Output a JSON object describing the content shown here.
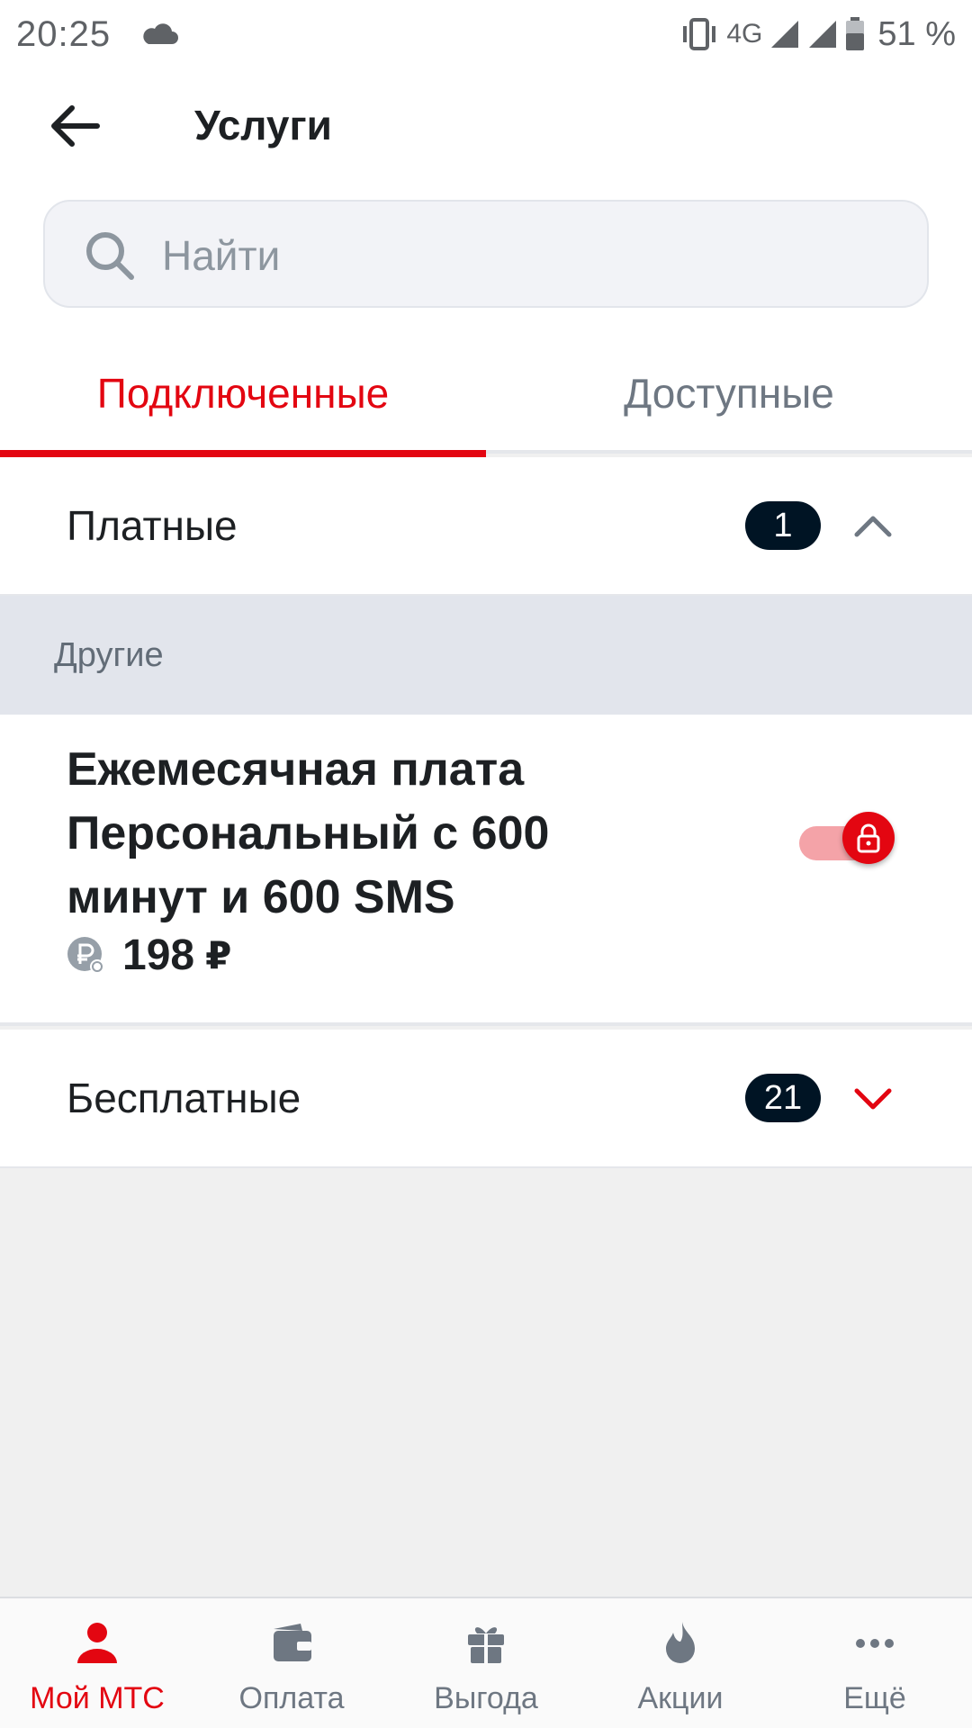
{
  "status_bar": {
    "time": "20:25",
    "network": "4G",
    "battery": "51 %",
    "icons": [
      "cloud-icon",
      "vibrate-icon",
      "signal-icon",
      "battery-icon"
    ]
  },
  "header": {
    "title": "Услуги"
  },
  "search": {
    "placeholder": "Найти"
  },
  "tabs": [
    {
      "label": "Подключенные",
      "active": true
    },
    {
      "label": "Доступные",
      "active": false
    }
  ],
  "sections": {
    "paid": {
      "label": "Платные",
      "count": "1",
      "expanded": true
    },
    "free": {
      "label": "Бесплатные",
      "count": "21",
      "expanded": false
    }
  },
  "group": {
    "label": "Другие"
  },
  "service": {
    "name": "Ежемесячная плата Персональный с 600 минут и 600 SMS",
    "price": "198",
    "currency": "₽",
    "enabled": true,
    "locked": true
  },
  "bottom_nav": [
    {
      "label": "Мой МТС",
      "icon": "person-icon",
      "active": true
    },
    {
      "label": "Оплата",
      "icon": "wallet-icon",
      "active": false
    },
    {
      "label": "Выгода",
      "icon": "gift-icon",
      "active": false
    },
    {
      "label": "Акции",
      "icon": "flame-icon",
      "active": false
    },
    {
      "label": "Ещё",
      "icon": "more-icon",
      "active": false
    }
  ],
  "colors": {
    "accent": "#e30611",
    "badge": "#001424",
    "group_bg": "#e2e5ec",
    "muted": "#6e7782"
  }
}
